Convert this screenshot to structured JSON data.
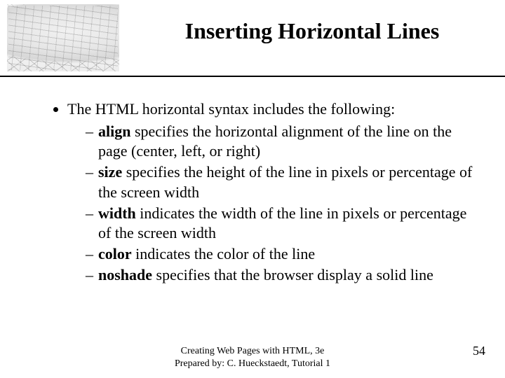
{
  "header": {
    "title": "Inserting Horizontal Lines"
  },
  "content": {
    "lead": "The HTML horizontal syntax includes the following:",
    "items": [
      {
        "term": "align",
        "rest": " specifies the horizontal alignment of the line on the page (center, left, or right)"
      },
      {
        "term": "size",
        "rest": " specifies the height of the line in pixels or percentage of the screen width"
      },
      {
        "term": "width",
        "rest": " indicates the width of the line in pixels or percentage of the screen width"
      },
      {
        "term": "color",
        "rest": " indicates the color of the line"
      },
      {
        "term": "noshade",
        "rest": " specifies that the browser display a solid line"
      }
    ]
  },
  "footer": {
    "line1": "Creating Web Pages with HTML, 3e",
    "line2": "Prepared by: C. Hueckstaedt, Tutorial 1",
    "page": "54"
  }
}
